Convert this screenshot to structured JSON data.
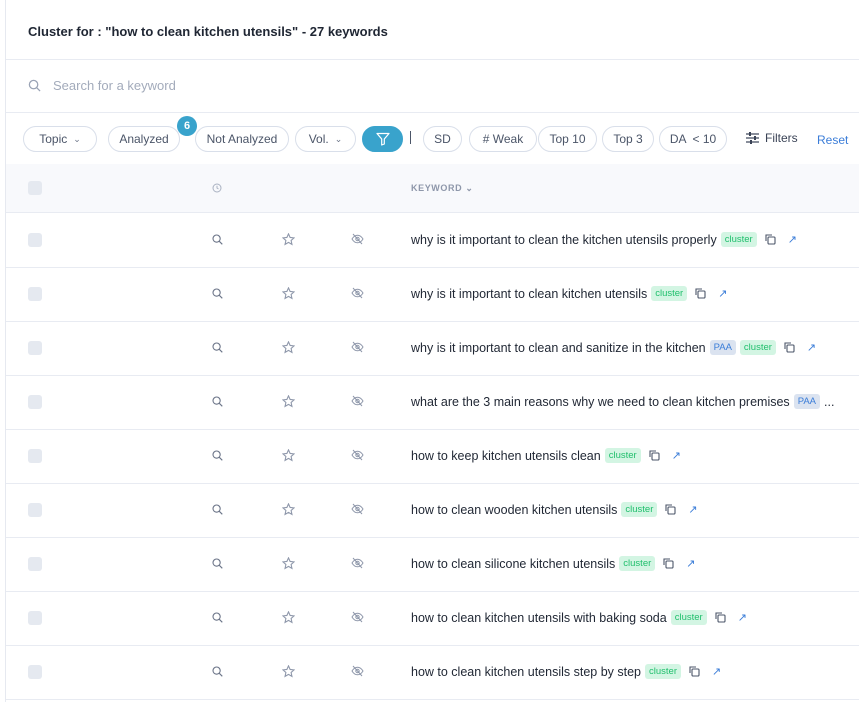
{
  "header": {
    "title": "Cluster for : \"how to clean kitchen utensils\" - 27 keywords"
  },
  "search": {
    "placeholder": "Search for a keyword",
    "value": ""
  },
  "filters": {
    "topic": "Topic",
    "analyzed": "Analyzed",
    "analyzed_count": "6",
    "not_analyzed": "Not Analyzed",
    "vol": "Vol.",
    "sd": "SD",
    "weak": "# Weak",
    "top10": "Top 10",
    "top3": "Top 3",
    "da": "DA  < 10",
    "filters": "Filters",
    "reset": "Reset",
    "accent": "#39a3cc"
  },
  "table": {
    "keyword_header": "KEYWORD",
    "rows": [
      {
        "keyword": "why is it important to clean the kitchen utensils properly",
        "tags": [
          "cluster"
        ]
      },
      {
        "keyword": "why is it important to clean kitchen utensils",
        "tags": [
          "cluster"
        ]
      },
      {
        "keyword": "why is it important to clean and sanitize in the kitchen",
        "tags": [
          "PAA",
          "cluster"
        ]
      },
      {
        "keyword": "what are the 3 main reasons why we need to clean kitchen premises",
        "tags": [
          "PAA"
        ],
        "truncated": "..."
      },
      {
        "keyword": "how to keep kitchen utensils clean",
        "tags": [
          "cluster"
        ]
      },
      {
        "keyword": "how to clean wooden kitchen utensils",
        "tags": [
          "cluster"
        ]
      },
      {
        "keyword": "how to clean silicone kitchen utensils",
        "tags": [
          "cluster"
        ]
      },
      {
        "keyword": "how to clean kitchen utensils with baking soda",
        "tags": [
          "cluster"
        ]
      },
      {
        "keyword": "how to clean kitchen utensils step by step",
        "tags": [
          "cluster"
        ]
      }
    ]
  }
}
